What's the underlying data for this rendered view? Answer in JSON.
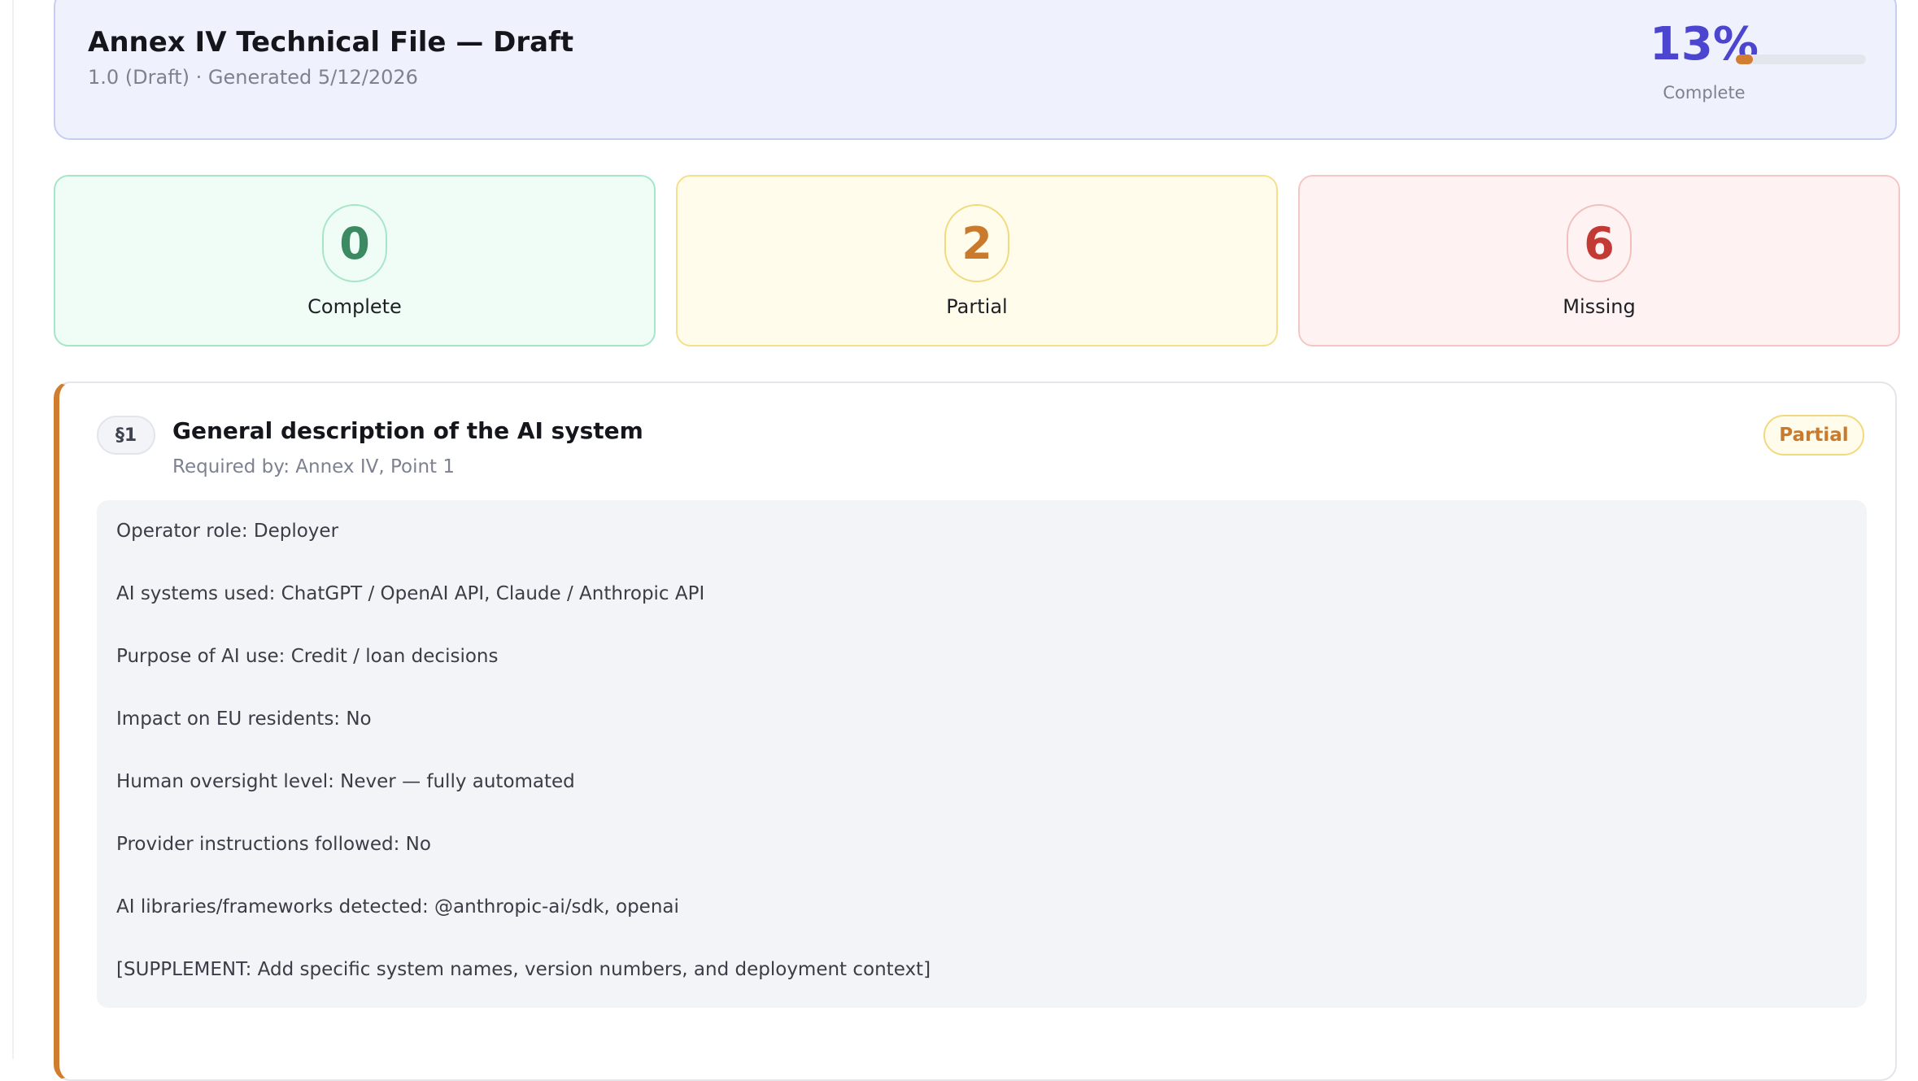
{
  "header": {
    "title": "Annex IV Technical File — Draft",
    "meta": "1.0 (Draft) · Generated 5/12/2026",
    "progress_percent": "13%",
    "progress_value": 13,
    "progress_caption": "Complete"
  },
  "stats": {
    "complete": {
      "count": "0",
      "label": "Complete"
    },
    "partial": {
      "count": "2",
      "label": "Partial"
    },
    "missing": {
      "count": "6",
      "label": "Missing"
    }
  },
  "section": {
    "number": "§1",
    "title": "General description of the AI system",
    "required_by": "Required by: Annex IV, Point 1",
    "status": "Partial",
    "lines": [
      "Operator role: Deployer",
      "AI systems used: ChatGPT / OpenAI API, Claude / Anthropic API",
      "Purpose of AI use: Credit / loan decisions",
      "Impact on EU residents: No",
      "Human oversight level: Never — fully automated",
      "Provider instructions followed: No",
      "AI libraries/frameworks detected: @anthropic-ai/sdk, openai",
      "[SUPPLEMENT: Add specific system names, version numbers, and deployment context]"
    ]
  },
  "colors": {
    "accent": "#4b45cf",
    "partial": "#c97a2c",
    "complete": "#3b8a62",
    "missing": "#c33a34",
    "progress_fill": "#d27d32"
  }
}
